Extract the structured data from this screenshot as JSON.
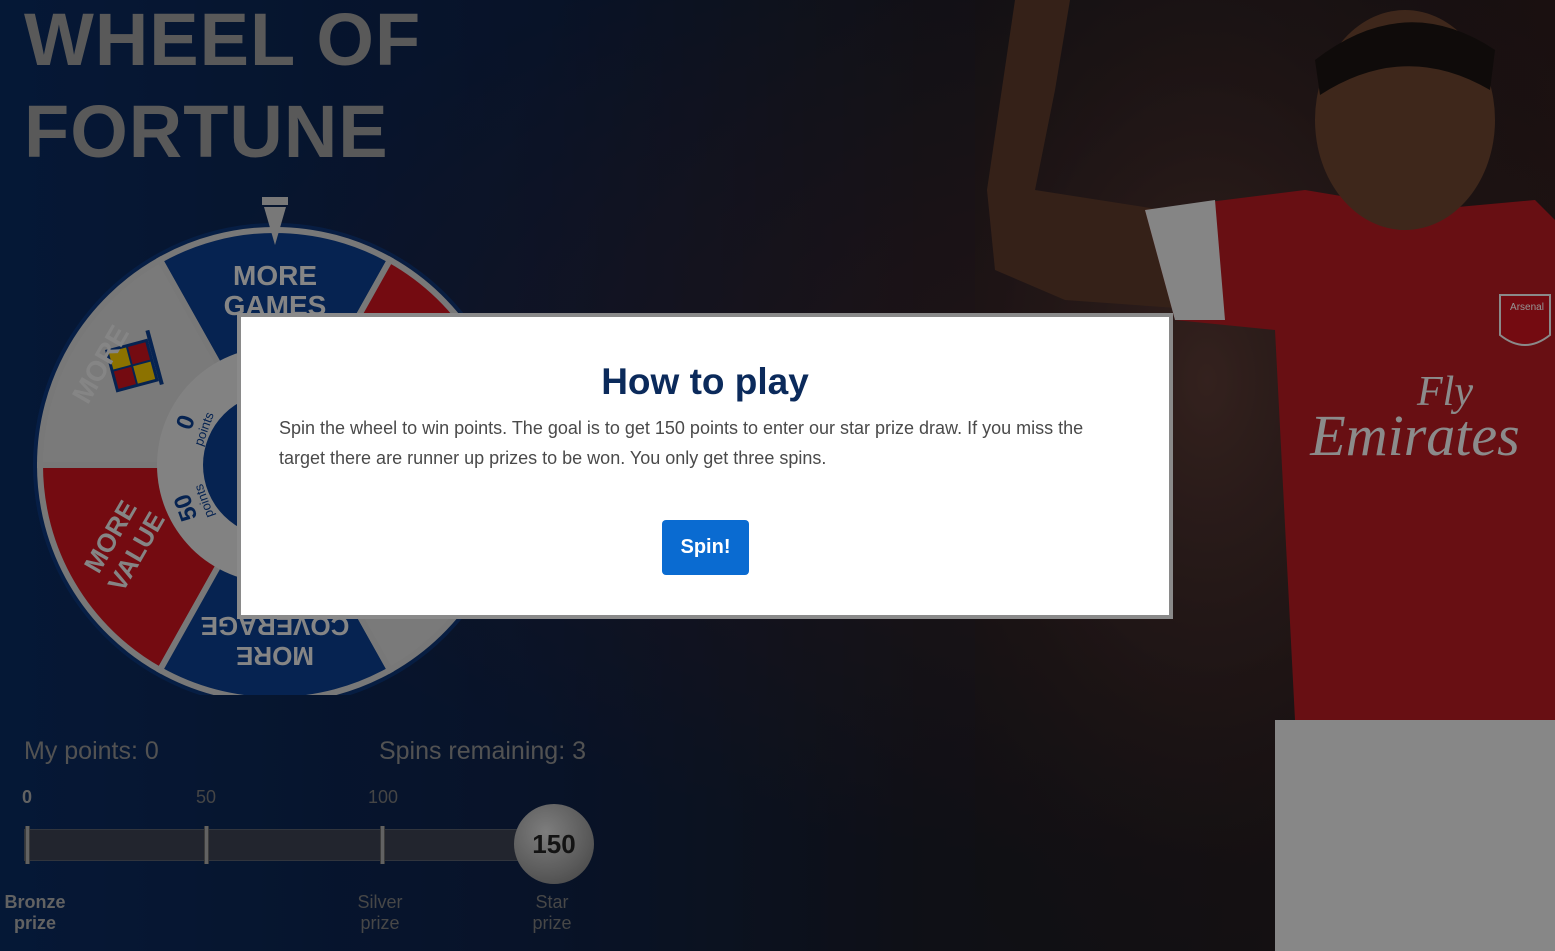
{
  "game": {
    "title_line1": "WHEEL OF",
    "title_line2": "FORTUNE"
  },
  "wheel": {
    "segments": {
      "more_games_top": "MORE",
      "more_games_bottom": "GAMES",
      "more_value_top": "MORE",
      "more_value_bottom": "VALUE",
      "more_coverage_top": "MORE",
      "more_coverage_bottom": "COVERAGE"
    },
    "inner": {
      "zero_value": "0",
      "zero_unit": "points",
      "fifty_value": "50",
      "fifty_unit": "points"
    }
  },
  "modal": {
    "title": "How to play",
    "body": "Spin the wheel to win points. The goal is to get 150 points to enter our star prize draw. If you miss the target there are runner up prizes to be won. You only get three spins.",
    "button_label": "Spin!"
  },
  "stats": {
    "points_label": "My points: 0",
    "spins_label": "Spins remaining: 3"
  },
  "progress": {
    "current_points": 0,
    "ticks": [
      "0",
      "50",
      "100"
    ],
    "goal": "150",
    "prizes": {
      "bronze_line1": "Bronze",
      "bronze_line2": "prize",
      "silver_line1": "Silver",
      "silver_line2": "prize",
      "star_line1": "Star",
      "star_line2": "prize"
    }
  },
  "background": {
    "jersey_sponsor_line1": "Fly",
    "jersey_sponsor_line2": "Emirates",
    "crest_text": "Arsenal"
  },
  "colors": {
    "modal_title": "#0b2a5b",
    "button": "#0a6bd1",
    "wheel_red": "#c8141e",
    "wheel_blue": "#0b3d8c",
    "wheel_grey": "#d2d2d2"
  }
}
